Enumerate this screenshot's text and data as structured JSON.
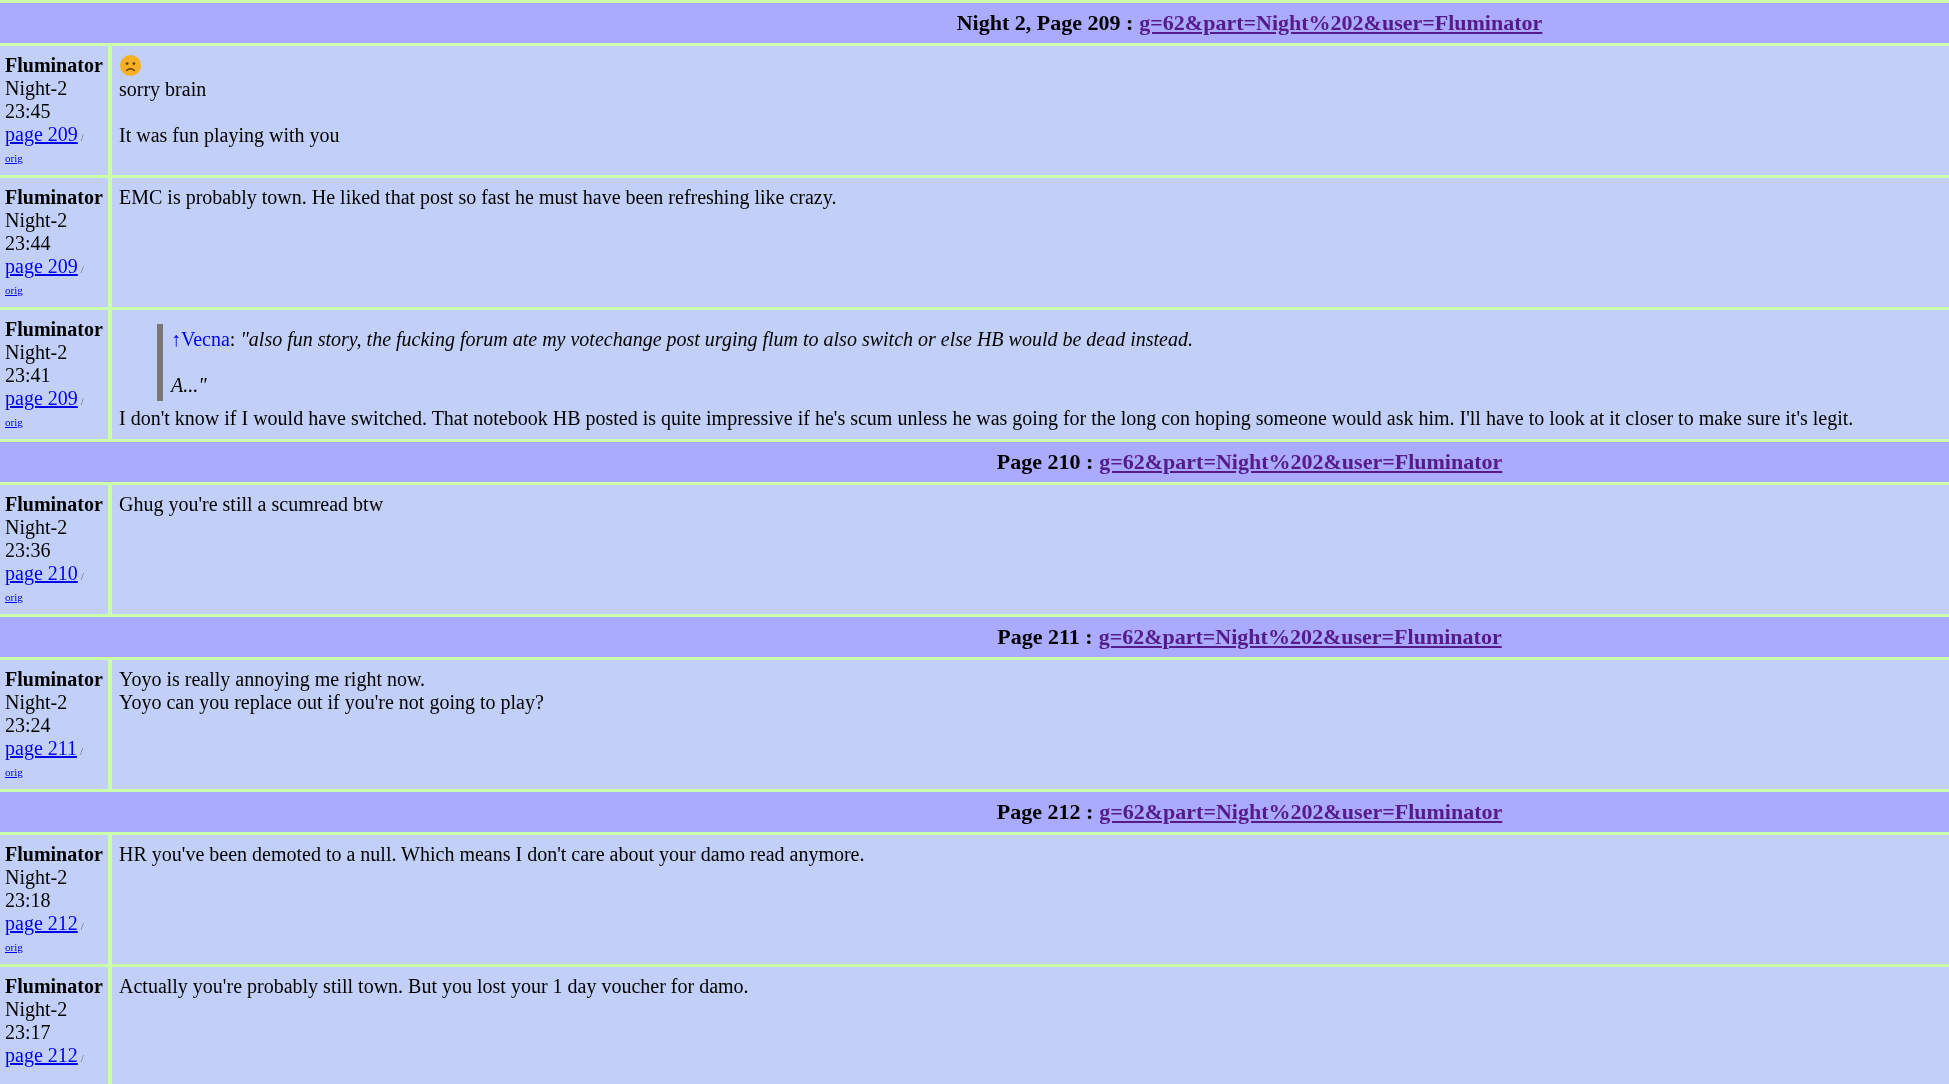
{
  "sections": [
    {
      "kind": "header",
      "label": "Night 2, Page 209 :",
      "link": "g=62&part=Night%202&user=Fluminator"
    },
    {
      "kind": "post",
      "author": "Fluminator",
      "phase": "Night-2",
      "time": "23:45",
      "page_link": "page 209",
      "slash": "/",
      "orig": "orig",
      "body": [
        {
          "kind": "emoji"
        },
        {
          "kind": "paragraph",
          "text": "sorry brain"
        },
        {
          "kind": "blank"
        },
        {
          "kind": "paragraph",
          "text": "It was fun playing with you"
        }
      ]
    },
    {
      "kind": "post",
      "author": "Fluminator",
      "phase": "Night-2",
      "time": "23:44",
      "page_link": "page 209",
      "slash": "/",
      "orig": "orig",
      "body": [
        {
          "kind": "paragraph",
          "text": "EMC is probably town. He liked that post so fast he must have been refreshing like crazy."
        }
      ]
    },
    {
      "kind": "post",
      "author": "Fluminator",
      "phase": "Night-2",
      "time": "23:41",
      "page_link": "page 209",
      "slash": "/",
      "orig": "orig",
      "body": [
        {
          "kind": "quote",
          "source": "↑Vecna",
          "separator": ":",
          "lines": [
            "\"also fun story, the fucking forum ate my votechange post urging flum to also switch or else HB would be dead instead.",
            "A...\""
          ]
        },
        {
          "kind": "paragraph",
          "text": "I don't know if I would have switched. That notebook HB posted is quite impressive if he's scum unless he was going for the long con hoping someone would ask him. I'll have to look at it closer to make sure it's legit."
        }
      ]
    },
    {
      "kind": "header",
      "label": "Page 210 :",
      "link": "g=62&part=Night%202&user=Fluminator"
    },
    {
      "kind": "post",
      "author": "Fluminator",
      "phase": "Night-2",
      "time": "23:36",
      "page_link": "page 210",
      "slash": "/",
      "orig": "orig",
      "body": [
        {
          "kind": "paragraph",
          "text": "Ghug you're still a scumread btw"
        }
      ]
    },
    {
      "kind": "header",
      "label": "Page 211 :",
      "link": "g=62&part=Night%202&user=Fluminator"
    },
    {
      "kind": "post",
      "author": "Fluminator",
      "phase": "Night-2",
      "time": "23:24",
      "page_link": "page 211",
      "slash": "/",
      "orig": "orig",
      "body": [
        {
          "kind": "paragraph",
          "text": "Yoyo is really annoying me right now."
        },
        {
          "kind": "paragraph",
          "text": "Yoyo can you replace out if you're not going to play?"
        }
      ]
    },
    {
      "kind": "header",
      "label": "Page 212 :",
      "link": "g=62&part=Night%202&user=Fluminator"
    },
    {
      "kind": "post",
      "author": "Fluminator",
      "phase": "Night-2",
      "time": "23:18",
      "page_link": "page 212",
      "slash": "/",
      "orig": "orig",
      "body": [
        {
          "kind": "paragraph",
          "text": "HR you've been demoted to a null. Which means I don't care about your damo read anymore."
        }
      ]
    },
    {
      "kind": "post",
      "author": "Fluminator",
      "phase": "Night-2",
      "time": "23:17",
      "page_link": "page 212",
      "slash": "/",
      "body": [
        {
          "kind": "paragraph",
          "text": "Actually you're probably still town. But you lost your 1 day voucher for damo."
        }
      ]
    }
  ]
}
